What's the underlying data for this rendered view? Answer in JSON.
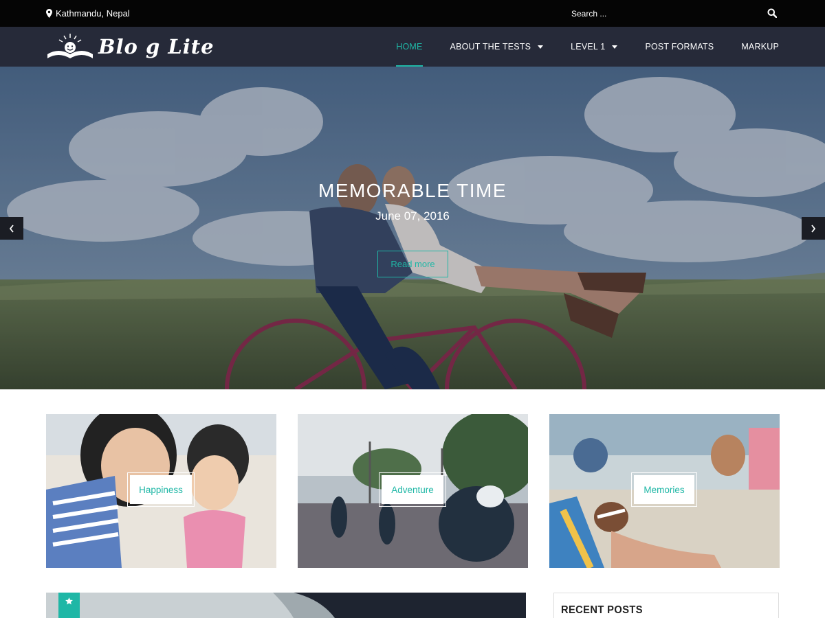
{
  "topbar": {
    "location": "Kathmandu, Nepal",
    "search_placeholder": "Search ..."
  },
  "header": {
    "logo_text": "Blo g Lite",
    "nav": [
      {
        "label": "HOME",
        "active": true,
        "has_dropdown": false
      },
      {
        "label": "ABOUT THE TESTS",
        "active": false,
        "has_dropdown": true
      },
      {
        "label": "LEVEL 1",
        "active": false,
        "has_dropdown": true
      },
      {
        "label": "POST FORMATS",
        "active": false,
        "has_dropdown": false
      },
      {
        "label": "MARKUP",
        "active": false,
        "has_dropdown": false
      }
    ]
  },
  "hero": {
    "title": "MEMORABLE TIME",
    "date": "June 07, 2016",
    "button_label": "Read more"
  },
  "features": [
    {
      "label": "Happiness"
    },
    {
      "label": "Adventure"
    },
    {
      "label": "Memories"
    }
  ],
  "sidebar": {
    "recent_posts_title": "RECENT POSTS"
  },
  "colors": {
    "accent": "#1fb7a6",
    "header_bg": "#262a39",
    "topbar_bg": "#050505"
  },
  "icons": {
    "location": "map-marker-icon",
    "search": "search-icon",
    "prev": "chevron-left-icon",
    "next": "chevron-right-icon",
    "featured": "star-icon"
  }
}
